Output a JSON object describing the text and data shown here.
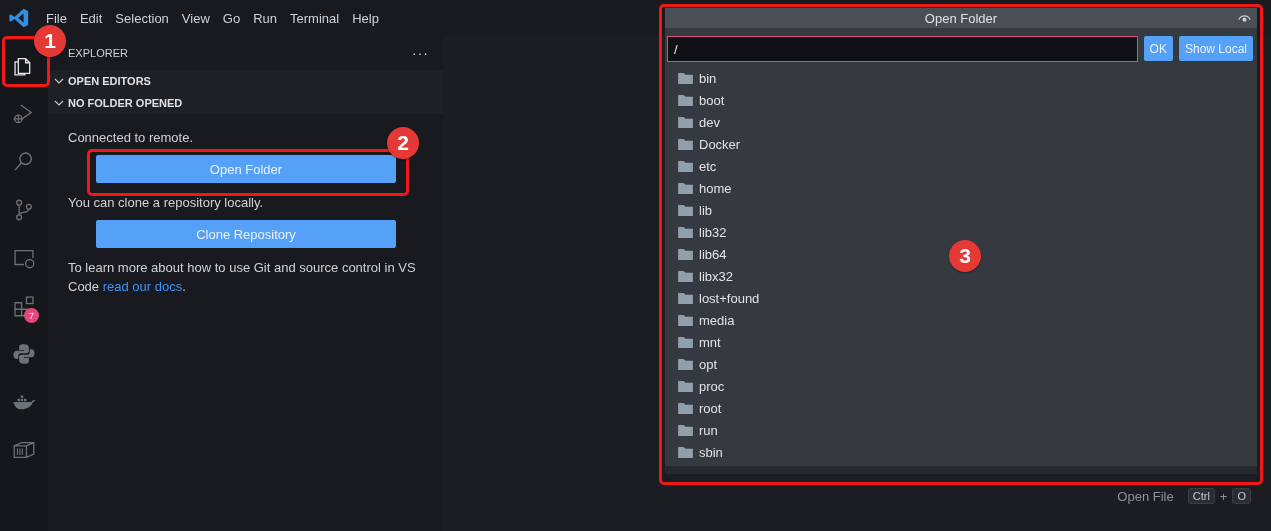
{
  "menu_bar": {
    "items": [
      "File",
      "Edit",
      "Selection",
      "View",
      "Go",
      "Run",
      "Terminal",
      "Help"
    ]
  },
  "activity_bar": {
    "items": [
      {
        "kind": "files",
        "selected": true
      },
      {
        "kind": "debug",
        "selected": false
      },
      {
        "kind": "search",
        "selected": false
      },
      {
        "kind": "git",
        "selected": false
      },
      {
        "kind": "remote",
        "selected": false
      },
      {
        "kind": "extensions",
        "selected": false,
        "badge": "7"
      },
      {
        "kind": "python",
        "selected": false
      },
      {
        "kind": "docker",
        "selected": false
      },
      {
        "kind": "container",
        "selected": false
      }
    ]
  },
  "sidebar": {
    "title": "EXPLORER",
    "more": "···",
    "sections": [
      {
        "title": "OPEN EDITORS",
        "expanded": true
      },
      {
        "title": "NO FOLDER OPENED",
        "expanded": true
      }
    ],
    "content": [
      {
        "kind": "text",
        "text": "Connected to remote."
      },
      {
        "kind": "button",
        "label": "Open Folder"
      },
      {
        "kind": "text",
        "text": "You can clone a repository locally."
      },
      {
        "kind": "button",
        "label": "Clone Repository"
      },
      {
        "kind": "text",
        "text": "To learn more about how to use Git and source control in VS Code ",
        "link": "read our docs",
        "after": "."
      }
    ]
  },
  "dialog": {
    "title": "Open Folder",
    "input": {
      "value": "/"
    },
    "buttons": [
      "OK",
      "Show Local"
    ],
    "items": [
      "bin",
      "boot",
      "dev",
      "Docker",
      "etc",
      "home",
      "lib",
      "lib32",
      "lib64",
      "libx32",
      "lost+found",
      "media",
      "mnt",
      "opt",
      "proc",
      "root",
      "run",
      "sbin"
    ]
  },
  "editor": {
    "shortcuts": [
      {
        "label": "Open File",
        "keys": [
          "Ctrl",
          "O"
        ],
        "separator": "+"
      }
    ]
  },
  "annotations": [
    {
      "number": "1"
    },
    {
      "number": "2"
    },
    {
      "number": "3"
    }
  ]
}
